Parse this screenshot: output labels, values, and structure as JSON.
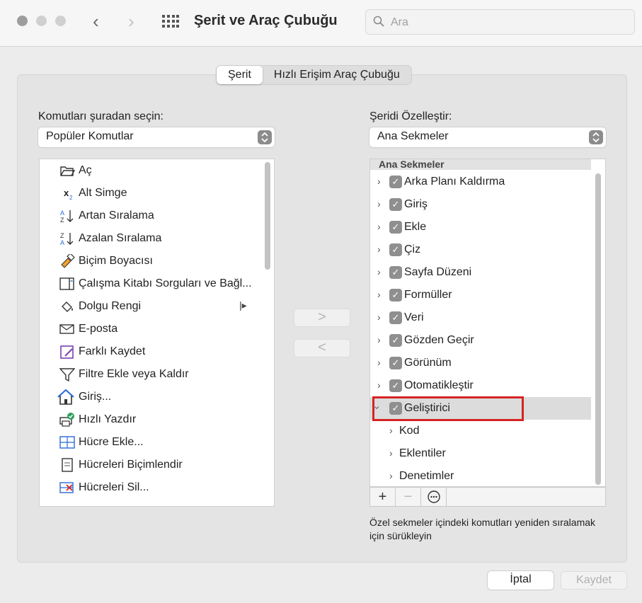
{
  "window": {
    "title": "Şerit ve Araç Çubuğu"
  },
  "search": {
    "placeholder": "Ara"
  },
  "tabs": [
    {
      "label": "Şerit",
      "active": true
    },
    {
      "label": "Hızlı Erişim Araç Çubuğu",
      "active": false
    }
  ],
  "left": {
    "label": "Komutları şuradan seçin:",
    "popup_value": "Popüler Komutlar",
    "items": [
      {
        "label": "Aç",
        "icon": "folder-open-icon"
      },
      {
        "label": "Alt Simge",
        "icon": "subscript-icon"
      },
      {
        "label": "Artan Sıralama",
        "icon": "sort-ascending-icon"
      },
      {
        "label": "Azalan Sıralama",
        "icon": "sort-descending-icon"
      },
      {
        "label": "Biçim Boyacısı",
        "icon": "format-painter-icon"
      },
      {
        "label": "Çalışma Kitabı Sorguları ve Bağl...",
        "icon": "queries-pane-icon"
      },
      {
        "label": "Dolgu Rengi",
        "icon": "fill-color-icon"
      },
      {
        "label": "E-posta",
        "icon": "email-icon"
      },
      {
        "label": "Farklı Kaydet",
        "icon": "save-as-icon"
      },
      {
        "label": "Filtre Ekle veya Kaldır",
        "icon": "filter-icon"
      },
      {
        "label": "Giriş...",
        "icon": "home-icon"
      },
      {
        "label": "Hızlı Yazdır",
        "icon": "quick-print-icon"
      },
      {
        "label": "Hücre Ekle...",
        "icon": "insert-cells-icon"
      },
      {
        "label": "Hücreleri Biçimlendir",
        "icon": "format-cells-icon"
      },
      {
        "label": "Hücreleri Sil...",
        "icon": "delete-cells-icon"
      }
    ]
  },
  "right": {
    "label": "Şeridi Özelleştir:",
    "popup_value": "Ana Sekmeler",
    "header": "Ana Sekmeler",
    "tabs": [
      {
        "label": "Arka Planı Kaldırma",
        "expanded": false
      },
      {
        "label": "Giriş",
        "expanded": false
      },
      {
        "label": "Ekle",
        "expanded": false
      },
      {
        "label": "Çiz",
        "expanded": false
      },
      {
        "label": "Sayfa Düzeni",
        "expanded": false
      },
      {
        "label": "Formüller",
        "expanded": false
      },
      {
        "label": "Veri",
        "expanded": false
      },
      {
        "label": "Gözden Geçir",
        "expanded": false
      },
      {
        "label": "Görünüm",
        "expanded": false
      },
      {
        "label": "Otomatikleştir",
        "expanded": false
      },
      {
        "label": "Geliştirici",
        "expanded": true,
        "selected": true
      }
    ],
    "groups": [
      {
        "label": "Kod"
      },
      {
        "label": "Eklentiler"
      },
      {
        "label": "Denetimler"
      }
    ],
    "hint": "Özel sekmeler içindeki komutları yeniden sıralamak için sürükleyin"
  },
  "buttons": {
    "add": "+",
    "move_right": ">",
    "move_left": "<",
    "cancel": "İptal",
    "save": "Kaydet"
  },
  "colors": {
    "highlight": "#d62424",
    "checkbox": "#8f8f8f"
  }
}
